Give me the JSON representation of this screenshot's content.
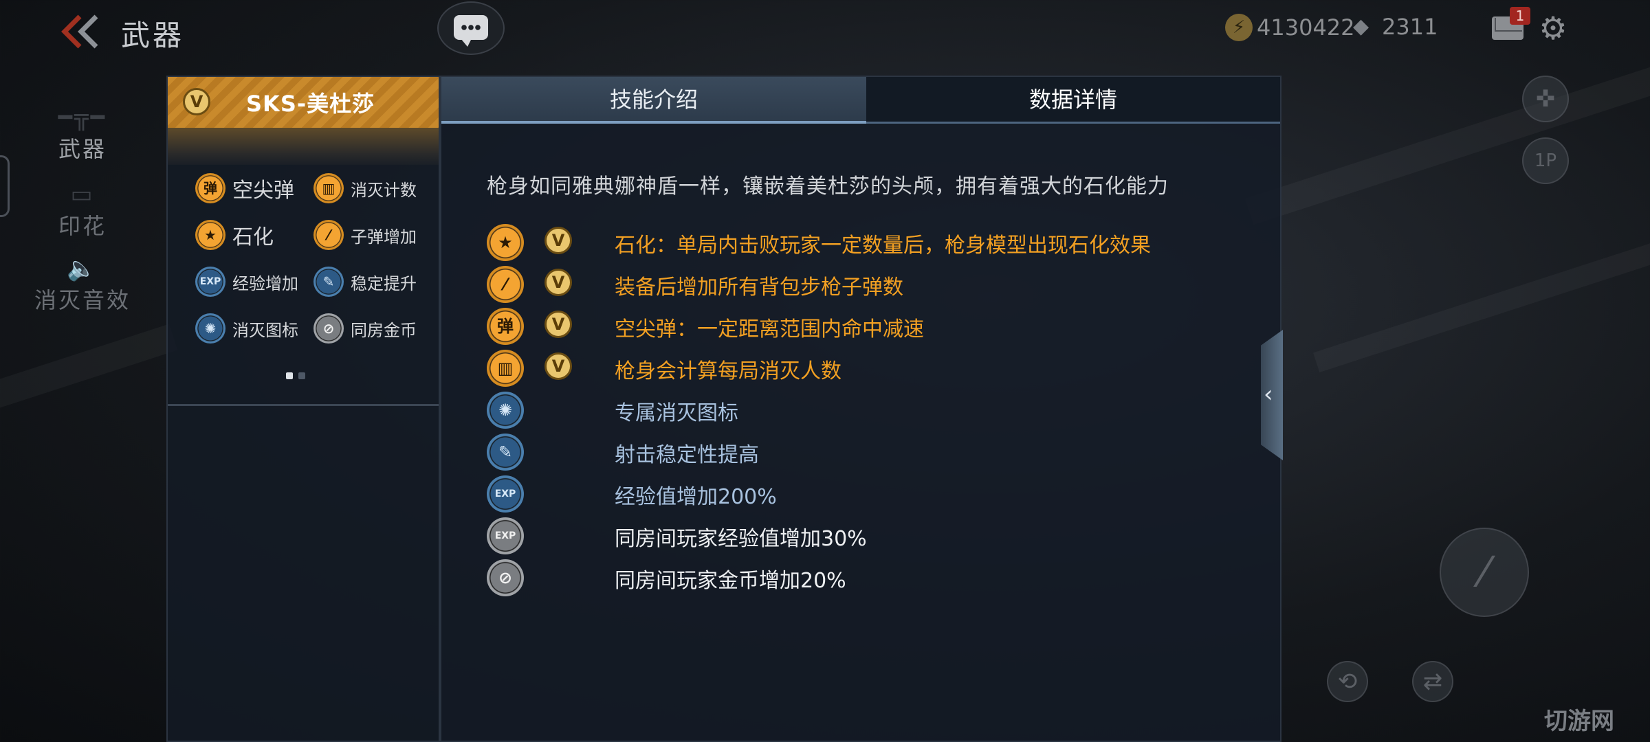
{
  "header": {
    "title": "武器",
    "chat_icon": "chat-icon"
  },
  "currency": {
    "gold": "4130422",
    "gems": "2311",
    "gold_icon": "coin-icon",
    "gem_icon": "diamond-icon"
  },
  "mail": {
    "badge": "1"
  },
  "nav": [
    {
      "label": "武器",
      "active": true
    },
    {
      "label": "印花",
      "active": false
    },
    {
      "label": "消灭音效",
      "active": false
    }
  ],
  "weapon": {
    "name": "SKS-美杜莎",
    "badge": "V",
    "features": [
      {
        "label": "空尖弹",
        "size": "large",
        "color": "orange",
        "glyph": "弹"
      },
      {
        "label": "消灭计数",
        "size": "small",
        "color": "orange",
        "glyph": "▥"
      },
      {
        "label": "石化",
        "size": "large",
        "color": "orange",
        "glyph": "★"
      },
      {
        "label": "子弹增加",
        "size": "small",
        "color": "orange",
        "glyph": "⁄"
      },
      {
        "label": "经验增加",
        "size": "small",
        "color": "blue",
        "glyph": "EXP"
      },
      {
        "label": "稳定提升",
        "size": "small",
        "color": "blue",
        "glyph": "✎"
      },
      {
        "label": "消灭图标",
        "size": "small",
        "color": "blue",
        "glyph": "✺"
      },
      {
        "label": "同房金币",
        "size": "small",
        "color": "grey",
        "glyph": "⊘"
      }
    ],
    "page_dots": {
      "current": 1,
      "total": 2
    }
  },
  "tabs": [
    {
      "label": "技能介绍",
      "active": true
    },
    {
      "label": "数据详情",
      "active": false
    }
  ],
  "description": "枪身如同雅典娜神盾一样，镶嵌着美杜莎的头颅，拥有着强大的石化能力",
  "skills": [
    {
      "icon": "star-icon",
      "glyph": "★",
      "color": "orange",
      "vip": true,
      "text": "石化：单局内击败玩家一定数量后，枪身模型出现石化效果",
      "text_color": "orange"
    },
    {
      "icon": "bullet-icon",
      "glyph": "⁄",
      "color": "orange",
      "vip": true,
      "text": "装备后增加所有背包步枪子弹数",
      "text_color": "orange"
    },
    {
      "icon": "hollow-point-icon",
      "glyph": "弹",
      "color": "orange",
      "vip": true,
      "text": "空尖弹：一定距离范围内命中减速",
      "text_color": "orange"
    },
    {
      "icon": "kill-counter-icon",
      "glyph": "▥",
      "color": "orange",
      "vip": true,
      "text": "枪身会计算每局消灭人数",
      "text_color": "orange"
    },
    {
      "icon": "kill-emblem-icon",
      "glyph": "✺",
      "color": "blue",
      "vip": false,
      "text": "专属消灭图标",
      "text_color": "blue"
    },
    {
      "icon": "stability-icon",
      "glyph": "✎",
      "color": "blue",
      "vip": false,
      "text": "射击稳定性提高",
      "text_color": "blue"
    },
    {
      "icon": "exp-icon",
      "glyph": "EXP",
      "color": "blue",
      "vip": false,
      "text": "经验值增加200%",
      "text_color": "blue"
    },
    {
      "icon": "room-exp-icon",
      "glyph": "EXP",
      "color": "grey",
      "vip": false,
      "text": "同房间玩家经验值增加30%",
      "text_color": "white"
    },
    {
      "icon": "room-coin-icon",
      "glyph": "⊘",
      "color": "grey",
      "vip": false,
      "text": "同房间玩家金币增加20%",
      "text_color": "white"
    }
  ],
  "watermark": "切游网",
  "colors": {
    "accent_orange": "#f3a022",
    "accent_blue": "#a8c2df",
    "panel": "#141b26",
    "tab_active": "#3a4a5c"
  }
}
